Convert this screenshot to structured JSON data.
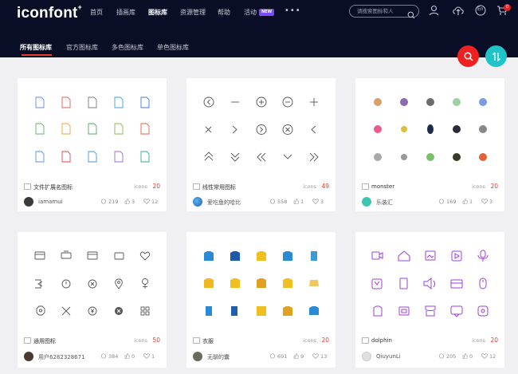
{
  "logo": "iconfont",
  "nav": [
    {
      "label": "首页",
      "active": false
    },
    {
      "label": "插画库",
      "active": false
    },
    {
      "label": "图标库",
      "active": true
    },
    {
      "label": "资源管理",
      "active": false
    },
    {
      "label": "帮助",
      "active": false
    },
    {
      "label": "活动",
      "active": false
    }
  ],
  "new_badge": "NEW",
  "search_placeholder": "请搜索图标和人",
  "lang": "En",
  "cart_count": "0",
  "tabs": [
    {
      "label": "所有图标库",
      "active": true
    },
    {
      "label": "官方图标库",
      "active": false
    },
    {
      "label": "多色图标库",
      "active": false
    },
    {
      "label": "单色图标库",
      "active": false
    }
  ],
  "colors": {
    "topbar": "#0a0d26",
    "accent_red": "#e43d2f",
    "fab_search": "#ef2020",
    "fab_sort": "#1ec4c8",
    "new_badge": "#7b4cf5"
  },
  "cards": [
    {
      "name": "文件扩展名图标",
      "icons_label": "icons",
      "count": "20",
      "user": "iamamui",
      "views": "219",
      "likes": "3",
      "favs": "12"
    },
    {
      "name": "线性常用图标",
      "icons_label": "icons",
      "count": "49",
      "user": "爱吃鱼的哈比",
      "views": "558",
      "likes": "1",
      "favs": "3"
    },
    {
      "name": "monster",
      "icons_label": "icons",
      "count": "20",
      "user": "乐装汇",
      "views": "169",
      "likes": "1",
      "favs": "3"
    },
    {
      "name": "通用图标",
      "icons_label": "icons",
      "count": "50",
      "user": "用户6282328671",
      "views": "384",
      "likes": "0",
      "favs": "1"
    },
    {
      "name": "衣服",
      "icons_label": "icons",
      "count": "20",
      "user": "无聊的囊",
      "views": "691",
      "likes": "9",
      "favs": "13"
    },
    {
      "name": "dolphin",
      "icons_label": "icons",
      "count": "20",
      "user": "QiuyunLi",
      "views": "205",
      "likes": "0",
      "favs": "12"
    }
  ]
}
